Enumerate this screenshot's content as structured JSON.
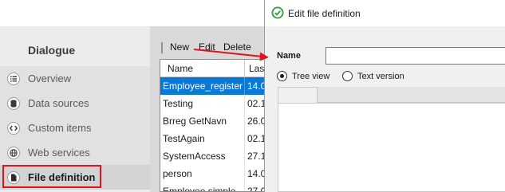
{
  "sidebar": {
    "title": "Dialogue",
    "items": [
      {
        "label": "Overview",
        "icon": "list-icon"
      },
      {
        "label": "Data sources",
        "icon": "database-icon"
      },
      {
        "label": "Custom items",
        "icon": "code-icon"
      },
      {
        "label": "Web services",
        "icon": "globe-icon"
      },
      {
        "label": "File definition",
        "icon": "file-icon",
        "active": true
      }
    ]
  },
  "toolbar": {
    "new_label": "New",
    "edit_label": "Edit",
    "delete_label": "Delete"
  },
  "grid": {
    "columns": [
      "Name",
      "Las"
    ],
    "rows": [
      {
        "name": "Employee_register",
        "date": "14.0",
        "selected": true
      },
      {
        "name": "Testing",
        "date": "02.1"
      },
      {
        "name": "Brreg GetNavn",
        "date": "26.0"
      },
      {
        "name": "TestAgain",
        "date": "02.1"
      },
      {
        "name": "SystemAccess",
        "date": "27.1"
      },
      {
        "name": "person",
        "date": "14.0"
      },
      {
        "name": "Employee simple",
        "date": "27.0"
      }
    ]
  },
  "dialog": {
    "title": "Edit file definition",
    "name_label": "Name",
    "name_value": "",
    "view_options": [
      "Tree view",
      "Text version"
    ],
    "selected_view": "Tree view"
  },
  "colors": {
    "selection": "#0a78d7",
    "highlight": "#e0141e",
    "title_icon": "#2e9a3e"
  }
}
